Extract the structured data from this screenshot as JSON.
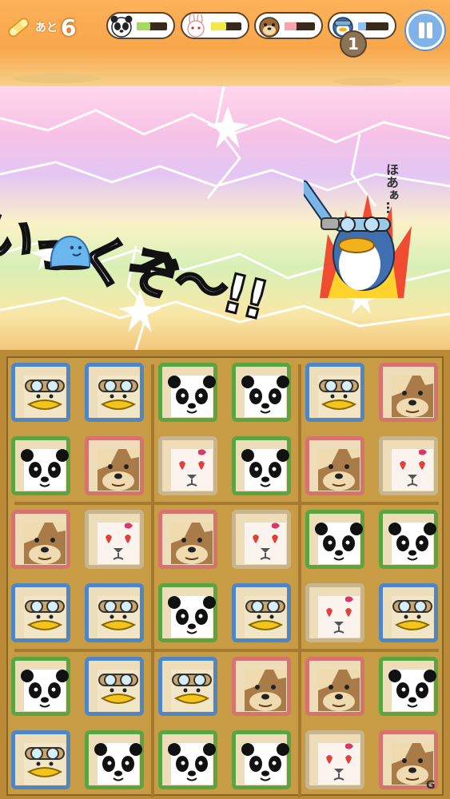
{
  "hud": {
    "moves_label": "あと",
    "moves_count": "6",
    "gauges": [
      {
        "character": "panda",
        "fill": 0.45,
        "color": "#a6d95f"
      },
      {
        "character": "rabbit",
        "fill": 0.5,
        "color": "#f0ea4a"
      },
      {
        "character": "tanuki",
        "fill": 0.4,
        "color": "#f7a3b0"
      },
      {
        "character": "penguin",
        "fill": 0.25,
        "color": "#8fc3f4"
      }
    ],
    "combo_badge": "1",
    "pause_icon": "pause-icon"
  },
  "scene": {
    "shout_text": "いっくぞ〜!!",
    "boss_voice": "ほあぁ…",
    "enemy": "blue-slime",
    "boss": "penguin-pilot"
  },
  "board": {
    "rows": [
      [
        "penguin",
        "penguin",
        "panda",
        "panda",
        "penguin",
        "tanuki"
      ],
      [
        "panda",
        "tanuki",
        "rabbit",
        "panda",
        "tanuki",
        "rabbit"
      ],
      [
        "tanuki",
        "rabbit",
        "tanuki",
        "rabbit",
        "panda",
        "panda"
      ],
      [
        "penguin",
        "penguin",
        "panda",
        "penguin",
        "rabbit",
        "penguin"
      ],
      [
        "panda",
        "penguin",
        "penguin",
        "tanuki",
        "tanuki",
        "panda"
      ],
      [
        "penguin",
        "panda",
        "panda",
        "panda",
        "rabbit",
        "tanuki"
      ]
    ]
  },
  "watermark": "G"
}
